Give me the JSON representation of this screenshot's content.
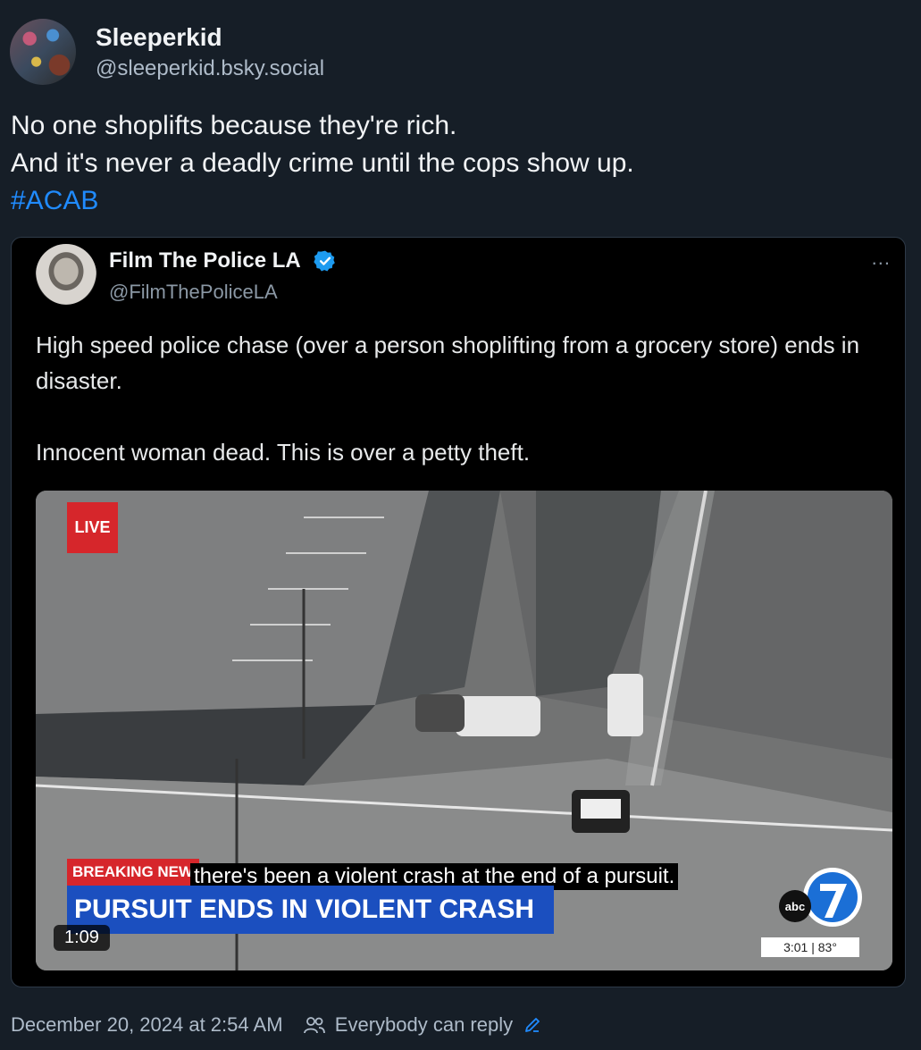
{
  "post": {
    "author_name": "Sleeperkid",
    "author_handle": "@sleeperkid.bsky.social",
    "text_line1": "No one shoplifts because they're rich.",
    "text_line2": "And it's never a deadly crime until the cops show up.",
    "hashtag": "#ACAB",
    "date": "December 20, 2024 at 2:54 AM",
    "reply_setting": "Everybody can reply"
  },
  "embed": {
    "author_name": "Film The Police LA",
    "author_handle": "@FilmThePoliceLA",
    "more": "...",
    "text_para1": "High speed police chase (over a person shoplifting from a grocery store) ends in disaster.",
    "text_para2": "Innocent woman dead. This is over a petty theft.",
    "video": {
      "live_badge": "LIVE",
      "breaking_label": "BREAKING NEWS",
      "caption": "there's been a violent crash at the end of a pursuit.",
      "banner": "PURSUIT ENDS IN VIOLENT CRASH",
      "duration": "1:09",
      "logo_text": "abc",
      "status": "3:01 | 83°"
    }
  },
  "colors": {
    "background": "#161e27",
    "link": "#208bfe",
    "live_red": "#d6262b",
    "banner_blue": "#1b4fbf"
  }
}
